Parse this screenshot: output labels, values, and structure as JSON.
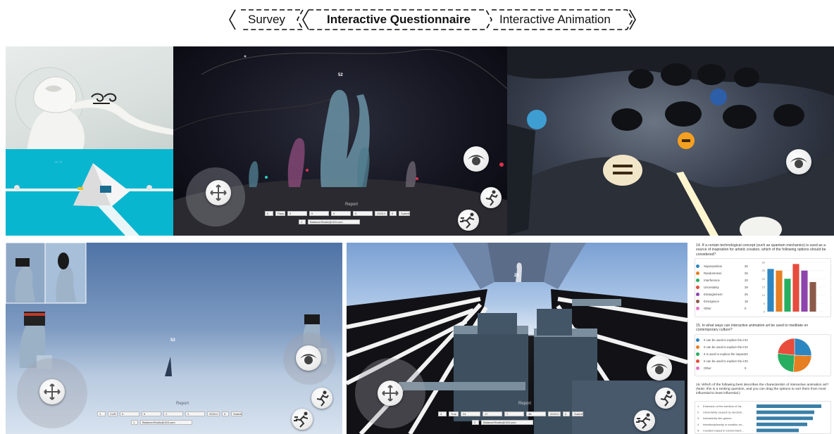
{
  "flow": {
    "steps": [
      "Survey",
      "Interactive Questionnaire",
      "Interactive Animation"
    ]
  },
  "scenes": {
    "dark_stage": {
      "counter": "52",
      "report_title": "Report",
      "row1": [
        "0",
        "Pass",
        "0",
        "0",
        "0",
        "0",
        "2023-0",
        "0",
        "Submit"
      ],
      "row2": [
        "1",
        "BalancerStudio@163.com"
      ]
    },
    "thinker": {
      "counter": "53",
      "report_title": "Report",
      "row1": [
        "1",
        "CUR",
        "0",
        "0",
        "1",
        "1",
        "2023-0",
        "0",
        "Submit"
      ],
      "row2": [
        "1",
        "BalancerStudio@163.com"
      ]
    },
    "corridor": {
      "counter": "21",
      "report_title": "Report",
      "row1": [
        "3",
        "True",
        "24",
        "17",
        "7",
        "38",
        "2023-0",
        "0",
        "Submit"
      ],
      "row2": [
        "2",
        "BalancerStudio@163.com"
      ]
    }
  },
  "icons": {
    "move": "move-arrows-icon",
    "eye": "eye-icon",
    "run": "running-figure-icon",
    "sprint": "sprint-figure-icon"
  },
  "questionnaire": {
    "q14": {
      "title": "14. If a certain technological concept (such as quantum mechanics) is used as a source of inspiration for artistic creation, which of the following options should be considered?",
      "chart_data": {
        "type": "bar",
        "categories": [
          "Superposition",
          "Randomness",
          "Interference",
          "Uncertainty",
          "Entanglement",
          "Emergence",
          "Other"
        ],
        "values": [
          26,
          25,
          20,
          29,
          25,
          18,
          0
        ],
        "colors": [
          "#2e86c1",
          "#e67e22",
          "#27ae60",
          "#e74c3c",
          "#8e44ad",
          "#8d5a4a",
          "#e377c2"
        ],
        "yticks": [
          "30",
          "25",
          "20",
          "15",
          "10",
          "5",
          "0"
        ],
        "ylim": [
          0,
          30
        ]
      }
    },
    "q15": {
      "title": "15. In what ways can interactive animation art be used to meditate on contemporary culture?",
      "chart_data": {
        "type": "pie",
        "categories": [
          "It can be used to explore the in...",
          "It can be used to explore the in...",
          "It is used to explore the impact ...",
          "It can be used to explore the in...",
          "Other"
        ],
        "values": [
          22,
          22,
          22,
          20,
          0
        ],
        "colors": [
          "#2e86c1",
          "#e67e22",
          "#27ae60",
          "#e74c3c",
          "#e377c2"
        ]
      }
    },
    "q16": {
      "title": "16. Which of the following best describes the characteristic of interactive animation art? (Note: this is a ranking question, and you can drag the options to sort them from most influential to least influential.)",
      "chart_data": {
        "type": "bar",
        "orientation": "horizontal",
        "categories": [
          "Extension of the medium of ha...",
          "Uncertainty caused by randomi...",
          "Interactivity like games",
          "Interdisciplinarity in creation an...",
          "Creation based in environment..."
        ],
        "values": [
          4.6,
          4.1,
          4.0,
          3.6,
          3.0
        ],
        "colors": [
          "#3a7fa8",
          "#3a7fa8",
          "#3a7fa8",
          "#3a7fa8",
          "#3a7fa8"
        ]
      }
    }
  }
}
